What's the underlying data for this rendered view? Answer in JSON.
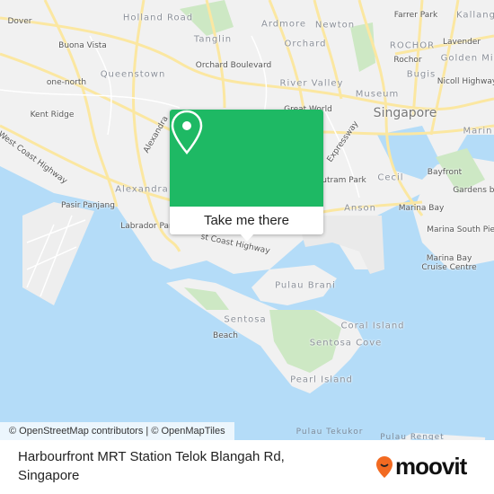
{
  "map": {
    "labels": {
      "dover": "Dover",
      "holland_road": "Holland Road",
      "buona_vista": "Buona Vista",
      "tanglin": "Tanglin",
      "queenstown": "Queenstown",
      "orchard_boulevard": "Orchard Boulevard",
      "one_north": "one-north",
      "kent_ridge": "Kent Ridge",
      "west_coast_highway": "West Coast Highway",
      "alexandra_road": "Alexandra",
      "alexandra": "Alexandra",
      "pasir_panjang": "Pasir Panjang",
      "labrador_park": "Labrador Par",
      "ardmore": "Ardmore",
      "newton": "Newton",
      "orchard": "Orchard",
      "farrer_park": "Farrer Park",
      "kallang": "Kallang",
      "rochor_district": "ROCHOR",
      "lavender": "Lavender",
      "rochor": "Rochor",
      "golden_mile": "Golden Mil",
      "bugis": "Bugis",
      "nicoll_highway": "Nicoll Highway",
      "river_valley": "River Valley",
      "museum": "Museum",
      "great_world": "Great World",
      "singapore": "Singapore",
      "marina": "Marin",
      "expressway": "Expressway",
      "outram_park": "utram Park",
      "cecil": "Cecil",
      "bayfront": "Bayfront",
      "gardens_by": "Gardens by",
      "anson": "Anson",
      "marina_bay": "Marina Bay",
      "marina_south_pier": "Marina South Pier",
      "marina_bay_cruise_centre_1": "Marina Bay",
      "marina_bay_cruise_centre_2": "Cruise Centre",
      "west_coast_highway_2": "st Coast Highway",
      "pulau_brani": "Pulau Brani",
      "sentosa": "Sentosa",
      "beach": "Beach",
      "coral_island": "Coral Island",
      "sentosa_cove": "Sentosa Cove",
      "pearl_island": "Pearl Island",
      "pulau_tekukor": "Pulau Tekukor",
      "pulau_renget": "Pulau Renget"
    },
    "colors": {
      "water": "#b4dcf8",
      "land": "#f1f1f1",
      "park": "#cde8c4",
      "road": "#fbe7a1",
      "accent": "#1eb964"
    },
    "attribution": "© OpenStreetMap contributors | © OpenMapTiles"
  },
  "popup": {
    "icon": "map-pin-icon",
    "button_label": "Take me there"
  },
  "footer": {
    "title": "Harbourfront MRT Station Telok Blangah Rd, Singapore",
    "logo": "moovit"
  }
}
